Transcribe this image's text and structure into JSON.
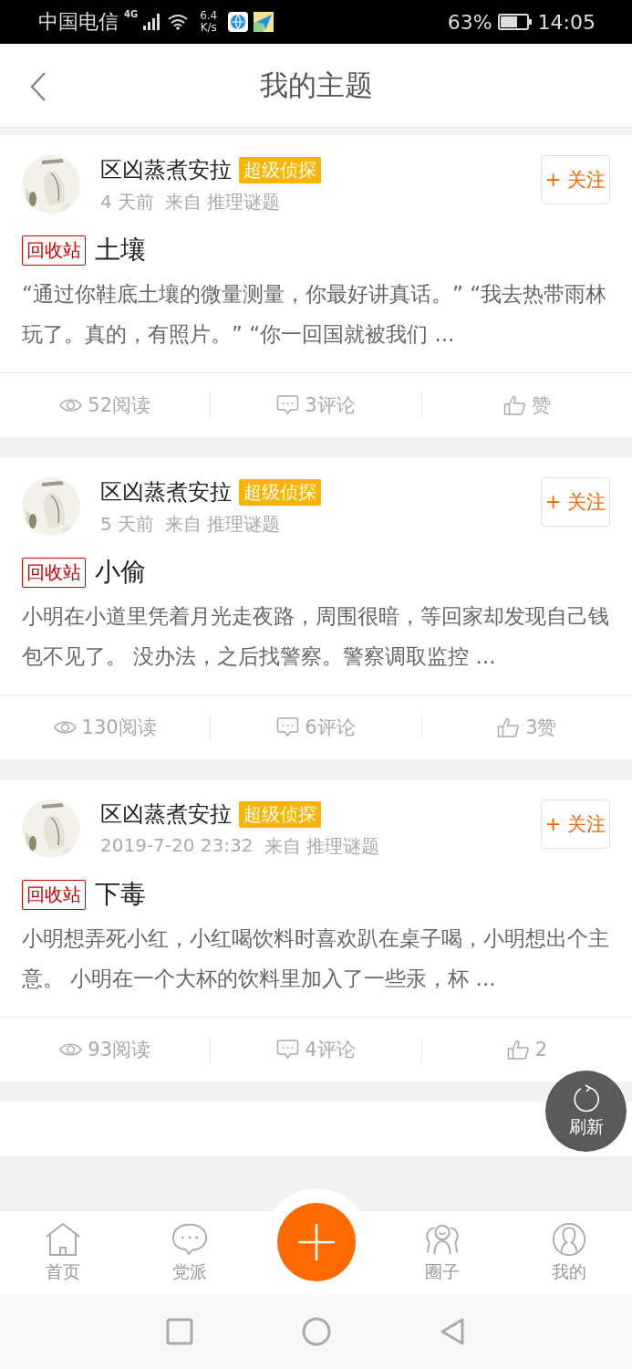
{
  "status_bar": {
    "carrier": "中国电信",
    "network": "4G",
    "speed_value": "6.4",
    "speed_unit": "K/s",
    "battery": "63%",
    "time": "14:05"
  },
  "header": {
    "title": "我的主题"
  },
  "posts": [
    {
      "author": "区凶蒸煮安拉",
      "badge": "超级侦探",
      "time": "4 天前",
      "source_prefix": "来自",
      "source": "推理谜题",
      "follow": "+ 关注",
      "tag": "回收站",
      "title": "土壤",
      "excerpt": "“通过你鞋底土壤的微量测量，你最好讲真话。” “我去热带雨林玩了。真的，有照片。” “你一回国就被我们 ...",
      "reads": "52阅读",
      "comments": "3评论",
      "likes": "赞"
    },
    {
      "author": "区凶蒸煮安拉",
      "badge": "超级侦探",
      "time": "5 天前",
      "source_prefix": "来自",
      "source": "推理谜题",
      "follow": "+ 关注",
      "tag": "回收站",
      "title": "小偷",
      "excerpt": "小明在小道里凭着月光走夜路，周围很暗，等回家却发现自己钱包不见了。 没办法，之后找警察。警察调取监控 ...",
      "reads": "130阅读",
      "comments": "6评论",
      "likes": "3赞"
    },
    {
      "author": "区凶蒸煮安拉",
      "badge": "超级侦探",
      "time": "2019-7-20 23:32",
      "source_prefix": "来自",
      "source": "推理谜题",
      "follow": "+ 关注",
      "tag": "回收站",
      "title": "下毒",
      "excerpt": "小明想弄死小红，小红喝饮料时喜欢趴在桌子喝，小明想出个主意。 小明在一个大杯的饮料里加入了一些汞，杯 ...",
      "reads": "93阅读",
      "comments": "4评论",
      "likes": "2"
    }
  ],
  "refresh_button": {
    "label": "刷新"
  },
  "tab_bar": {
    "items": [
      {
        "kind": "home",
        "label": "首页"
      },
      {
        "kind": "chat",
        "label": "党派"
      },
      {
        "kind": "compose"
      },
      {
        "kind": "group",
        "label": "圈子"
      },
      {
        "kind": "profile",
        "label": "我的"
      }
    ]
  }
}
